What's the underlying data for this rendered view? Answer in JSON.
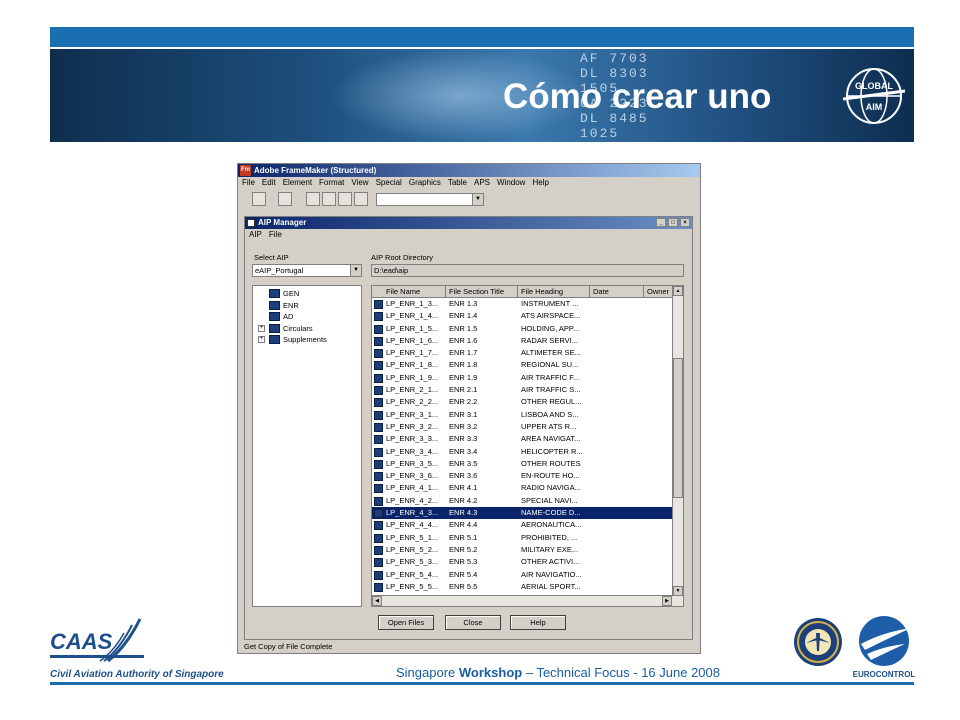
{
  "slide": {
    "title": "Cómo crear uno",
    "footer_prefix": "Singapore ",
    "footer_bold": "Workshop",
    "footer_suffix": " – Technical Focus - 16 June 2008",
    "caas_name": "Civil Aviation Authority of Singapore",
    "caas_logo_text": "CAAS",
    "euro_logo_text": "EUROCONTROL",
    "global_aim_text_1": "GLOBAL",
    "global_aim_text_2": "AIM",
    "banner_board": [
      "AF  7703",
      "DL  8303",
      "     1505",
      "UA  2223",
      "DL  8485",
      "     1025"
    ],
    "colors": {
      "accent": "#1a6fb0",
      "selection": "#0a246a"
    }
  },
  "app": {
    "title": "Adobe FrameMaker (Structured)",
    "menu": [
      "File",
      "Edit",
      "Element",
      "Format",
      "View",
      "Special",
      "Graphics",
      "Table",
      "APS",
      "Window",
      "Help"
    ]
  },
  "aip_manager": {
    "title": "AIP Manager",
    "menu": [
      "AIP",
      "File"
    ],
    "select_aip_label": "Select AIP",
    "select_aip_value": "eAIP_Portugal",
    "root_dir_label": "AIP Root Directory",
    "root_dir_value": "D:\\ead\\aip",
    "tree": [
      {
        "label": "GEN",
        "expandable": false
      },
      {
        "label": "ENR",
        "expandable": false
      },
      {
        "label": "AD",
        "expandable": false
      },
      {
        "label": "Circulars",
        "expandable": true
      },
      {
        "label": "Supplements",
        "expandable": true
      }
    ],
    "columns": [
      "File Name",
      "File Section Title",
      "File Heading",
      "Date",
      "Owner"
    ],
    "rows": [
      [
        "LP_ENR_1_3...",
        "ENR 1.3",
        "INSTRUMENT ..."
      ],
      [
        "LP_ENR_1_4...",
        "ENR 1.4",
        "ATS AIRSPACE..."
      ],
      [
        "LP_ENR_1_5...",
        "ENR 1.5",
        "HOLDING, APP..."
      ],
      [
        "LP_ENR_1_6...",
        "ENR 1.6",
        "RADAR SERVI..."
      ],
      [
        "LP_ENR_1_7...",
        "ENR 1.7",
        "ALTIMETER SE..."
      ],
      [
        "LP_ENR_1_8...",
        "ENR 1.8",
        "REGIONAL SU..."
      ],
      [
        "LP_ENR_1_9...",
        "ENR 1.9",
        "AIR TRAFFIC F..."
      ],
      [
        "LP_ENR_2_1...",
        "ENR 2.1",
        "AIR TRAFFIC S..."
      ],
      [
        "LP_ENR_2_2...",
        "ENR 2.2",
        "OTHER REGUL..."
      ],
      [
        "LP_ENR_3_1...",
        "ENR 3.1",
        "LISBOA AND S..."
      ],
      [
        "LP_ENR_3_2...",
        "ENR 3.2",
        "UPPER ATS R..."
      ],
      [
        "LP_ENR_3_3...",
        "ENR 3.3",
        "AREA NAVIGAT..."
      ],
      [
        "LP_ENR_3_4...",
        "ENR 3.4",
        "HELICOPTER R..."
      ],
      [
        "LP_ENR_3_5...",
        "ENR 3.5",
        "OTHER ROUTES"
      ],
      [
        "LP_ENR_3_6...",
        "ENR 3.6",
        "EN-ROUTE HO..."
      ],
      [
        "LP_ENR_4_1...",
        "ENR 4.1",
        "RADIO NAVIGA..."
      ],
      [
        "LP_ENR_4_2...",
        "ENR 4.2",
        "SPECIAL NAVI..."
      ],
      [
        "LP_ENR_4_3...",
        "ENR 4.3",
        "NAME-CODE D..."
      ],
      [
        "LP_ENR_4_4...",
        "ENR 4.4",
        "AERONAUTICA..."
      ],
      [
        "LP_ENR_5_1...",
        "ENR 5.1",
        "PROHIBITED, ..."
      ],
      [
        "LP_ENR_5_2...",
        "ENR 5.2",
        "MILITARY EXE..."
      ],
      [
        "LP_ENR_5_3...",
        "ENR 5.3",
        "OTHER ACTIVI..."
      ],
      [
        "LP_ENR_5_4...",
        "ENR 5.4",
        "AIR NAVIGATIO..."
      ],
      [
        "LP_ENR_5_5...",
        "ENR 5.5",
        "AERIAL SPORT..."
      ]
    ],
    "selected_row": 17,
    "buttons": {
      "open": "Open Files",
      "close": "Close",
      "help": "Help"
    },
    "status": "Get Copy of File Complete"
  }
}
